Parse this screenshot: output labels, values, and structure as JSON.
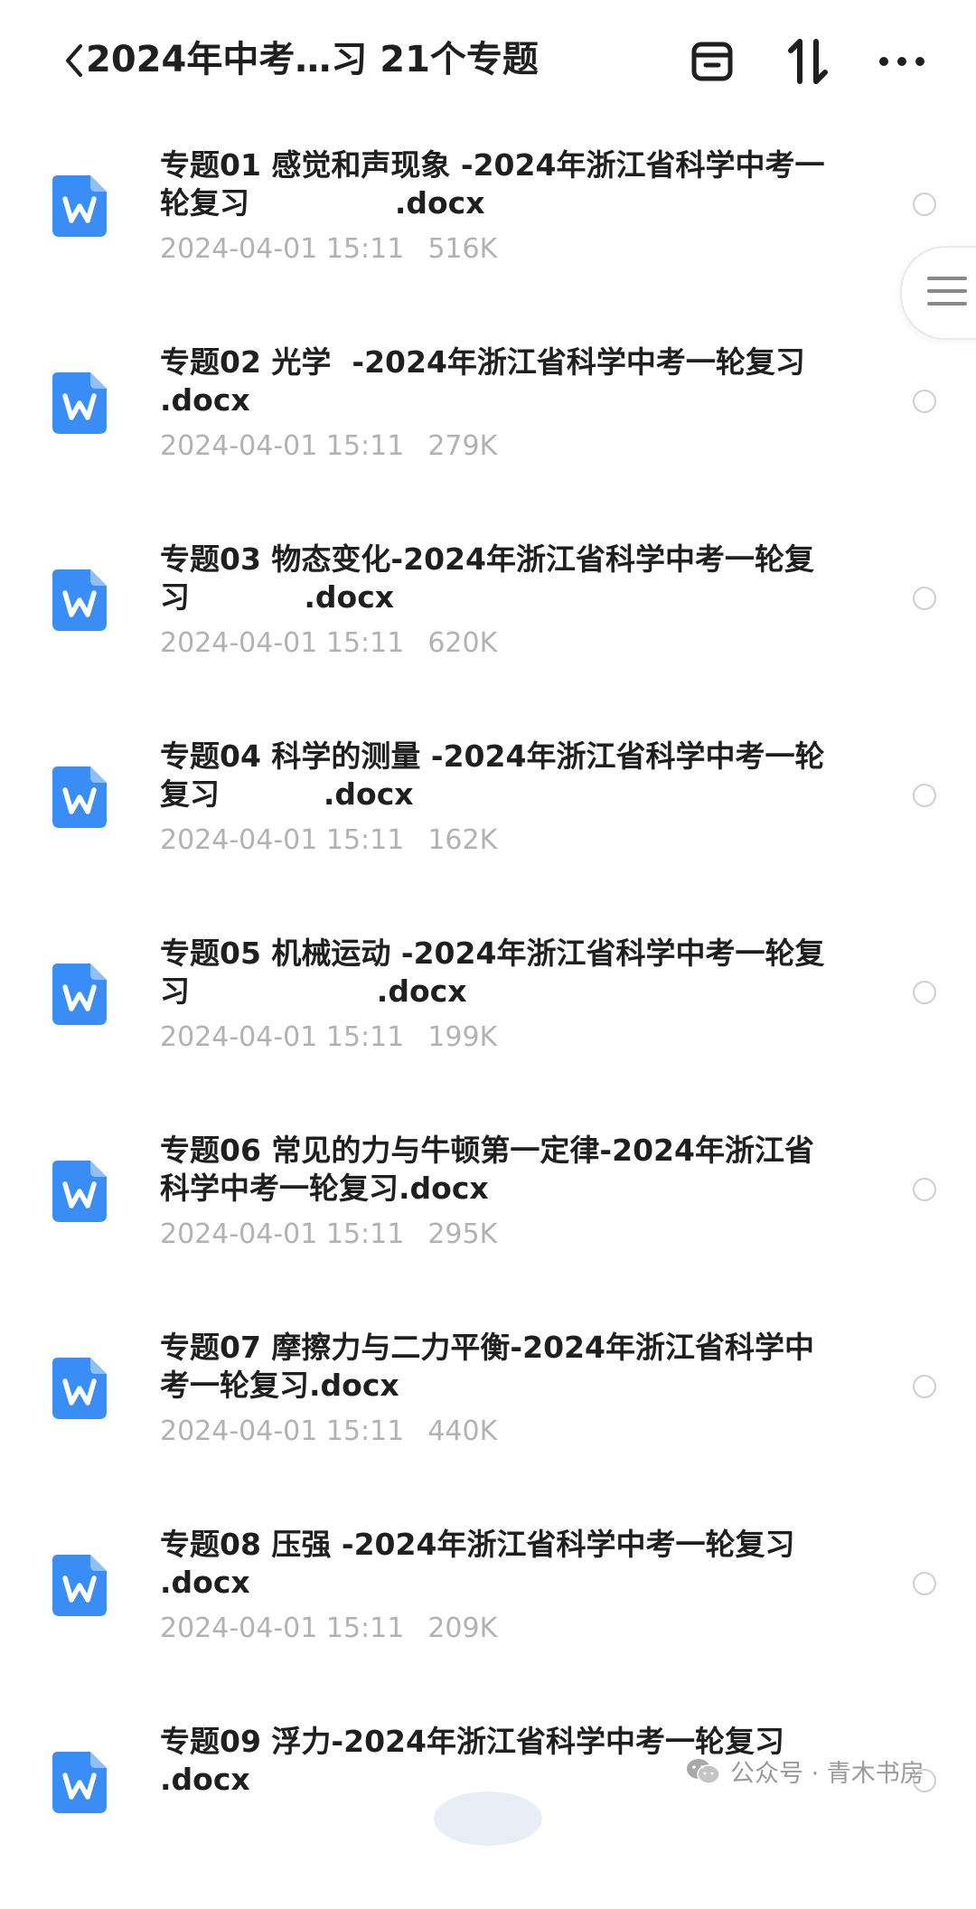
{
  "header": {
    "back_icon": "chevron-left-icon",
    "title": "2024年中考…习 21个专题",
    "actions": [
      "archive-icon",
      "sort-icon",
      "more-icon"
    ]
  },
  "files": [
    {
      "title": "专题01 感觉和声现象 -2024年浙江省科学中考一轮复习              .docx",
      "date": "2024-04-01 15:11",
      "size": "516K"
    },
    {
      "title": "专题02 光学  -2024年浙江省科学中考一轮复习              .docx",
      "date": "2024-04-01 15:11",
      "size": "279K"
    },
    {
      "title": "专题03 物态变化-2024年浙江省科学中考一轮复习           .docx",
      "date": "2024-04-01 15:11",
      "size": "620K"
    },
    {
      "title": "专题04 科学的测量 -2024年浙江省科学中考一轮复习          .docx",
      "date": "2024-04-01 15:11",
      "size": "162K"
    },
    {
      "title": "专题05 机械运动 -2024年浙江省科学中考一轮复习                  .docx",
      "date": "2024-04-01 15:11",
      "size": "199K"
    },
    {
      "title": "专题06 常见的力与牛顿第一定律-2024年浙江省科学中考一轮复习.docx",
      "date": "2024-04-01 15:11",
      "size": "295K"
    },
    {
      "title": "专题07 摩擦力与二力平衡-2024年浙江省科学中考一轮复习.docx",
      "date": "2024-04-01 15:11",
      "size": "440K"
    },
    {
      "title": "专题08 压强 -2024年浙江省科学中考一轮复习                    .docx",
      "date": "2024-04-01 15:11",
      "size": "209K"
    },
    {
      "title": "专题09 浮力-2024年浙江省科学中考一轮复习                  .docx",
      "date": "",
      "size": ""
    }
  ],
  "watermark": {
    "text": "公众号 · 青木书房",
    "icon": "wechat-icon"
  },
  "colors": {
    "doc_icon": "#3a8df4",
    "meta_text": "#b2b2b2"
  }
}
